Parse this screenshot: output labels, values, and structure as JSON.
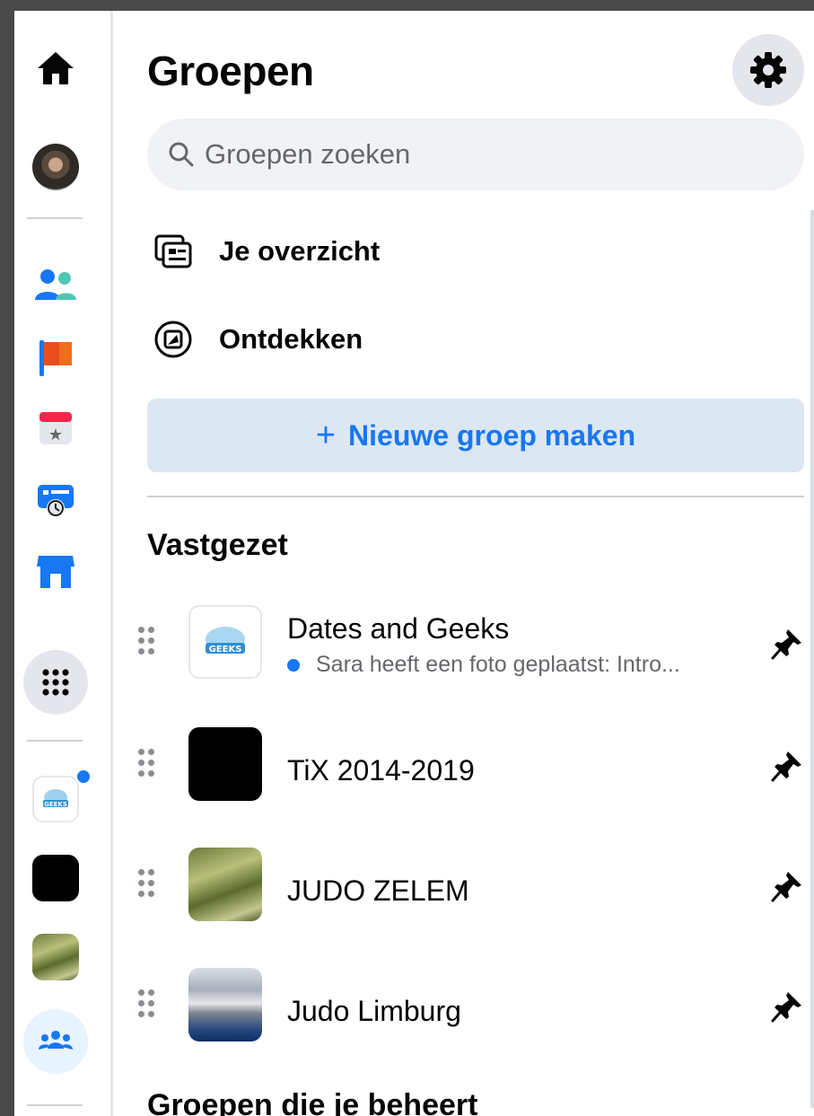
{
  "header": {
    "title": "Groepen"
  },
  "search": {
    "placeholder": "Groepen zoeken"
  },
  "menu": {
    "overview_label": "Je overzicht",
    "discover_label": "Ontdekken"
  },
  "create_button": {
    "plus": "+",
    "label": "Nieuwe groep maken"
  },
  "pinned": {
    "section_title": "Vastgezet",
    "groups": [
      {
        "name": "Dates and Geeks",
        "subtitle": "Sara heeft een foto geplaatst: Intro...",
        "unread": true
      },
      {
        "name": "TiX 2014-2019"
      },
      {
        "name": "JUDO ZELEM"
      },
      {
        "name": "Judo Limburg"
      }
    ]
  },
  "managed": {
    "section_title": "Groepen die je beheert"
  },
  "rail": {
    "icons": [
      "home-icon",
      "profile-avatar",
      "friends-icon",
      "pages-flag-icon",
      "events-calendar-icon",
      "memories-icon",
      "marketplace-icon",
      "apps-grid-icon",
      "groups-icon"
    ]
  },
  "colors": {
    "accent": "#1877f2",
    "create_bg": "#dbe7f2",
    "search_bg": "#f0f2f5",
    "icon_bg": "#e4e6eb"
  }
}
